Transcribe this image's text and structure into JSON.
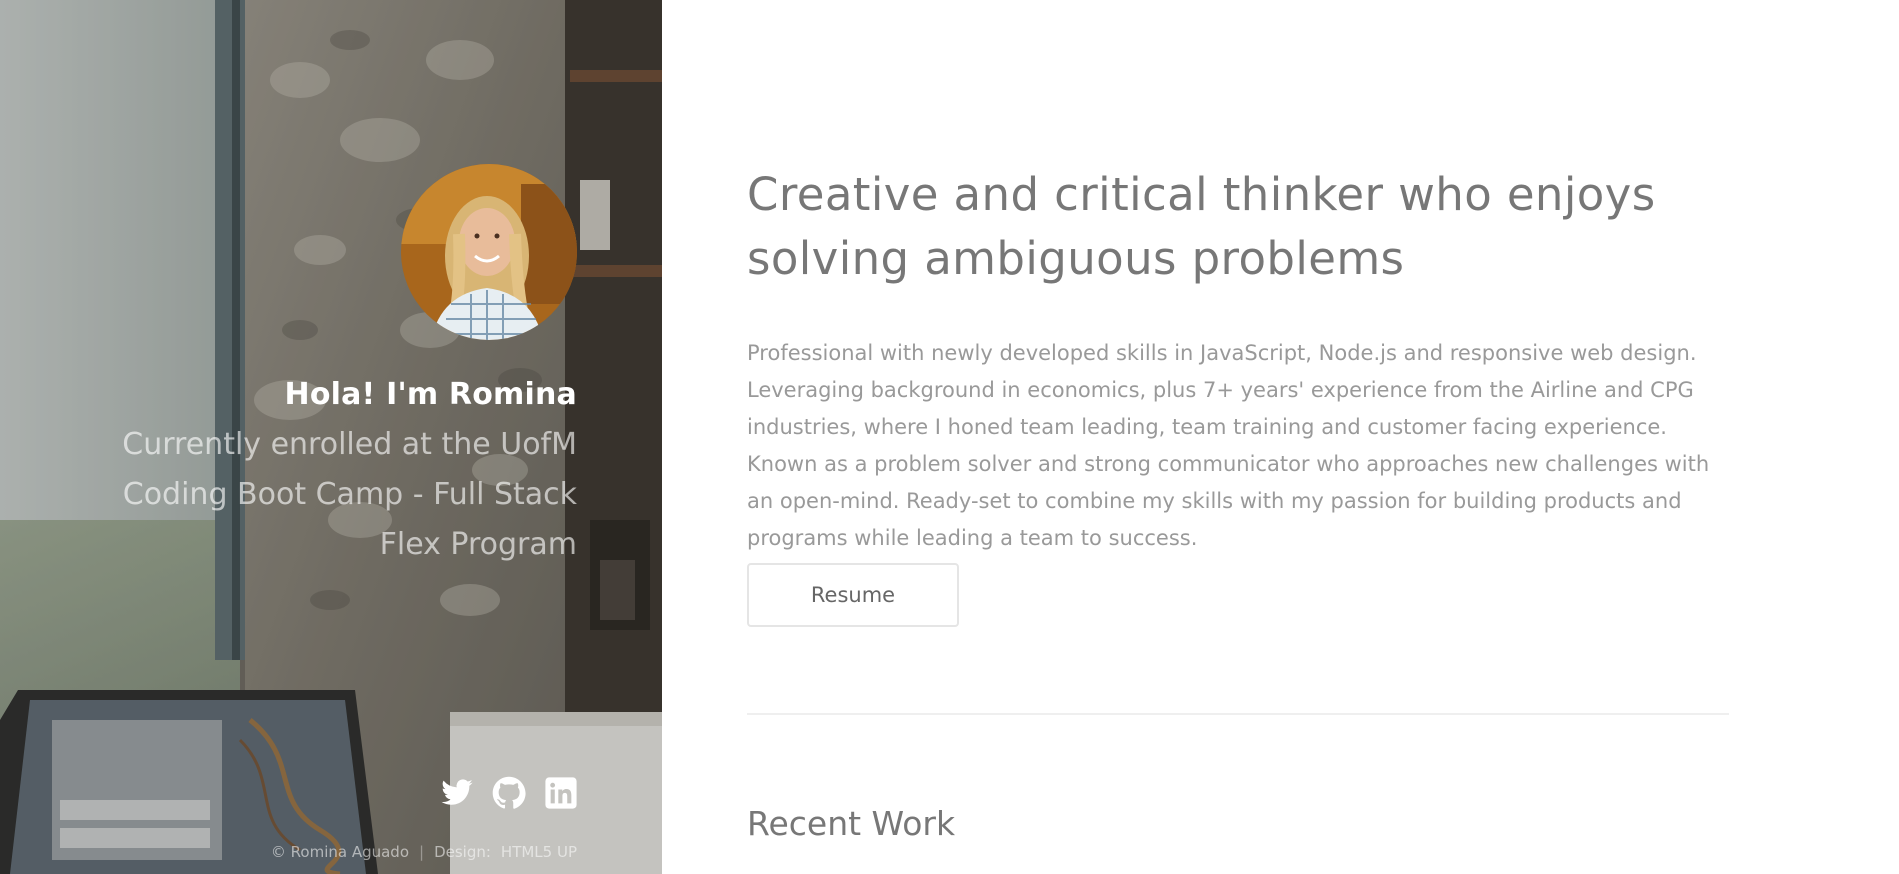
{
  "header": {
    "intro_name": "Hola! I'm Romina",
    "intro_description": "Currently enrolled at the UofM Coding Boot Camp - Full Stack Flex Program",
    "social": [
      {
        "icon": "twitter-icon"
      },
      {
        "icon": "github-icon"
      },
      {
        "icon": "linkedin-icon"
      }
    ],
    "copyright": "© Romina Aguado",
    "design_credit": "Design:",
    "design_link": "HTML5 UP"
  },
  "main": {
    "headline": "Creative and critical thinker who enjoys solving ambiguous problems",
    "bio": "Professional with newly developed skills in JavaScript, Node.js and responsive web design. Leveraging background in economics, plus 7+ years' experience from the Airline and CPG industries, where I honed team leading, team training and customer facing experience. Known as a problem solver and strong communicator who approaches new challenges with an open-mind. Ready-set to combine my skills with my passion for building products and programs while leading a team to success.",
    "resume_label": "Resume",
    "recent_work_heading": "Recent Work"
  },
  "colors": {
    "heading_text": "#777777",
    "body_text": "#999999",
    "button_border": "#e5e5e5"
  }
}
